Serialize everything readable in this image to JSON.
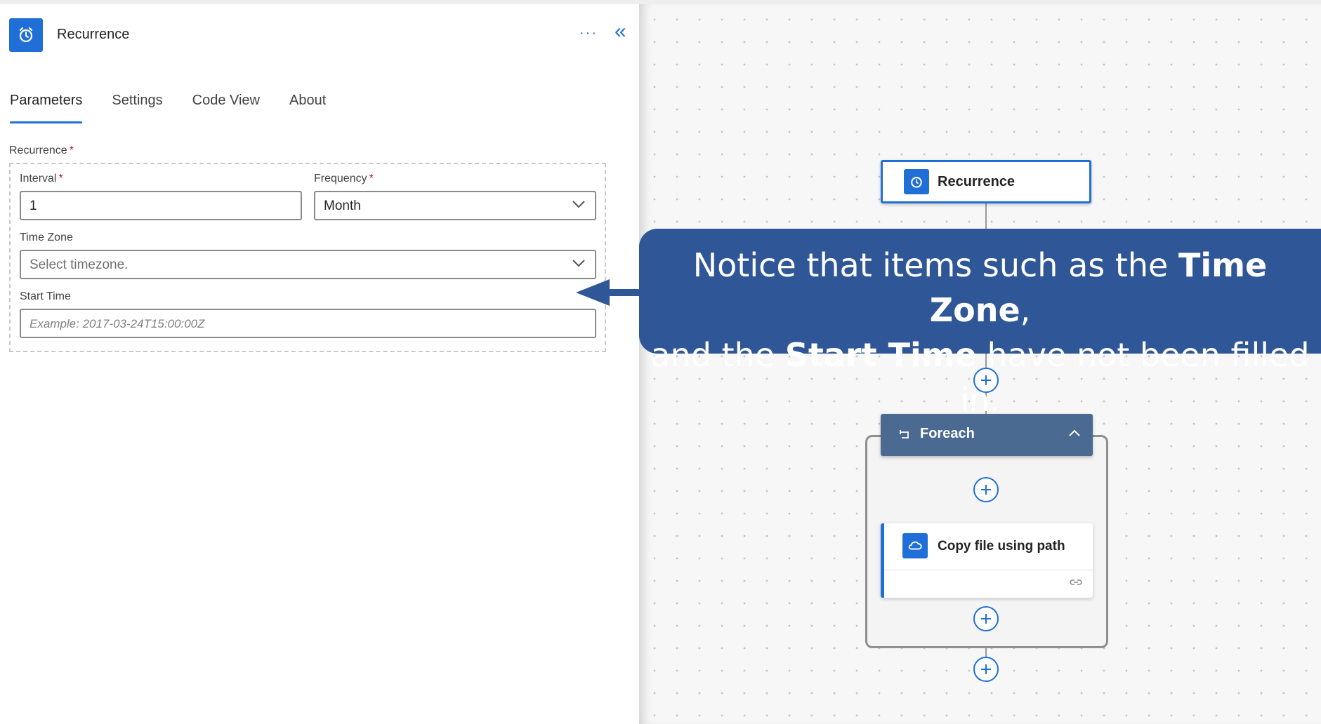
{
  "panel": {
    "title": "Recurrence",
    "more_label": "···",
    "collapse_label": "«",
    "tabs": [
      {
        "label": "Parameters",
        "active": true
      },
      {
        "label": "Settings",
        "active": false
      },
      {
        "label": "Code View",
        "active": false
      },
      {
        "label": "About",
        "active": false
      }
    ],
    "section_label": "Recurrence",
    "required_mark": "*",
    "interval": {
      "label": "Interval",
      "value": "1"
    },
    "frequency": {
      "label": "Frequency",
      "value": "Month"
    },
    "time_zone": {
      "label": "Time Zone",
      "placeholder": "Select timezone."
    },
    "start_time": {
      "label": "Start Time",
      "placeholder": "Example: 2017-03-24T15:00:00Z"
    }
  },
  "canvas": {
    "recurrence_node": {
      "title": "Recurrence"
    },
    "foreach_node": {
      "title": "Foreach"
    },
    "copy_node": {
      "title": "Copy file using path"
    }
  },
  "callout": {
    "line1_prefix": "Notice that items such as the ",
    "line1_bold": "Time Zone",
    "line1_suffix": ",",
    "line2_prefix": "and the ",
    "line2_bold": "Start Time",
    "line2_suffix": " have not been filled in."
  },
  "colors": {
    "accent": "#1f6fd6",
    "callout": "#2f5696",
    "foreach_header": "#4a6a91",
    "required": "#c50f1f"
  },
  "icons": [
    "alarm-clock-icon",
    "more-options-icon",
    "collapse-double-chevron-icon",
    "chevron-down-icon",
    "plus-circle-icon",
    "loop-icon",
    "chevron-up-icon",
    "cloud-file-icon",
    "link-icon"
  ]
}
